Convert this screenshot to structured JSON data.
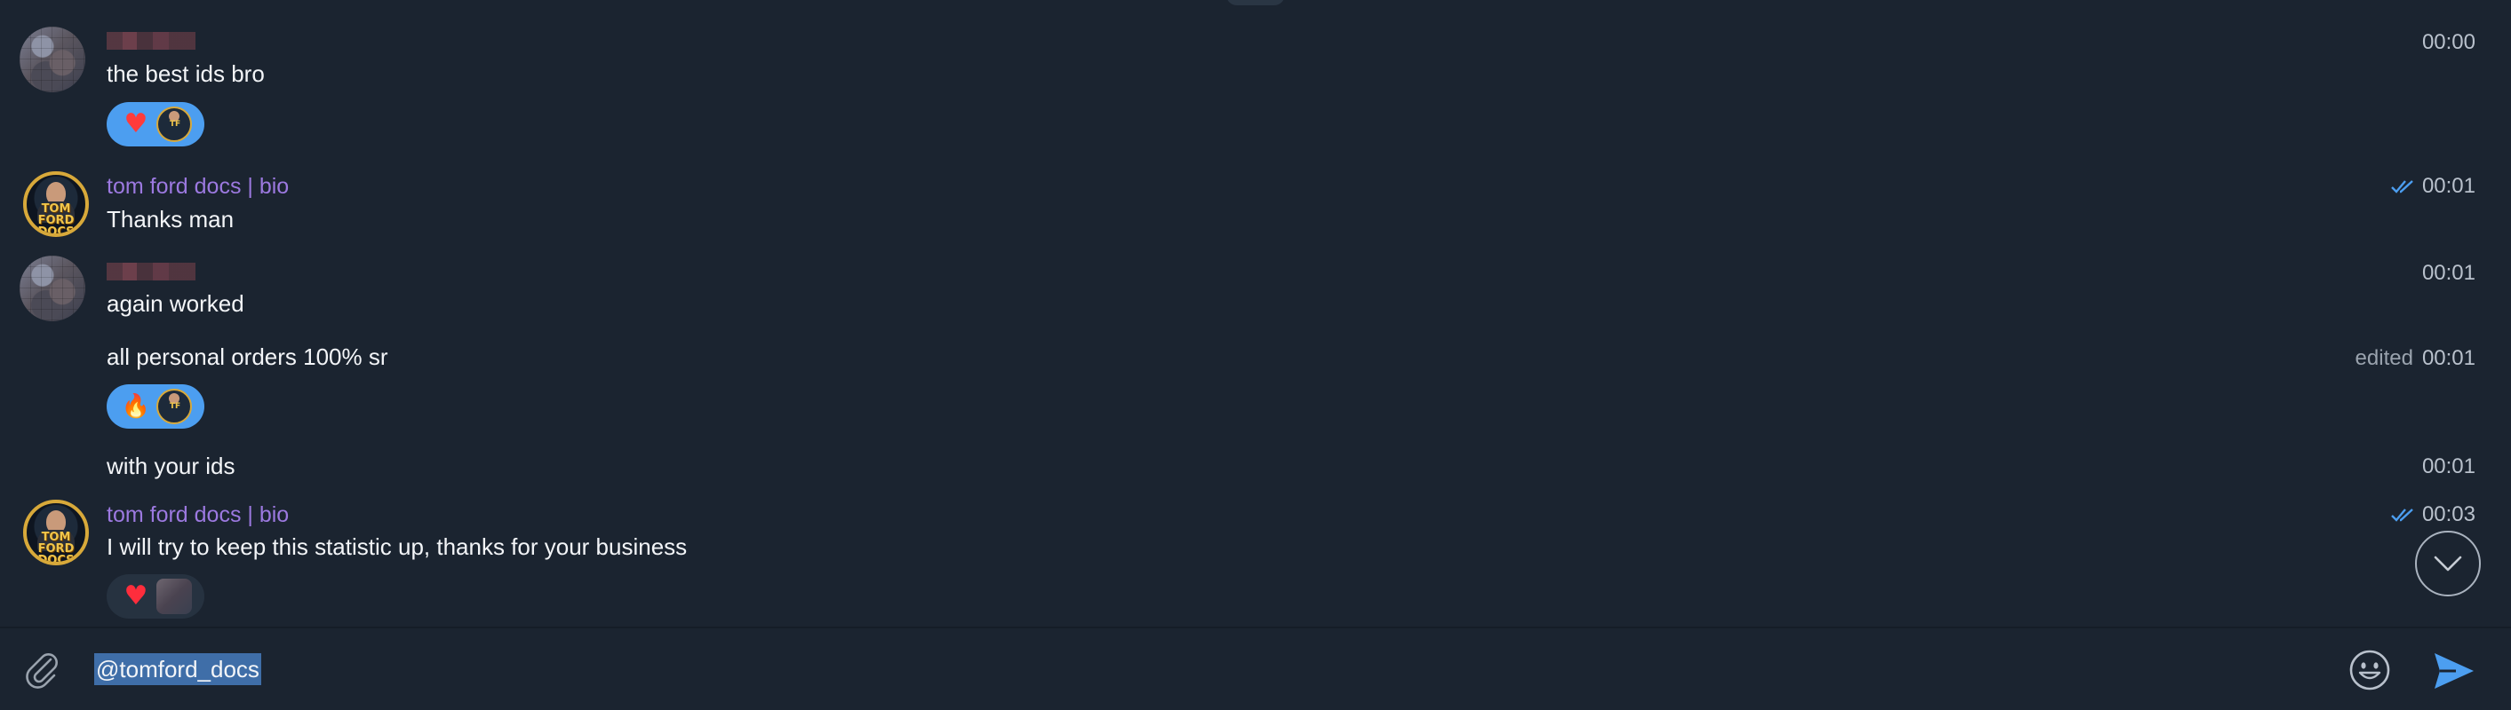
{
  "messages": [
    {
      "text": "the best ids bro",
      "time": "00:00"
    },
    {
      "sender": "tom ford docs | bio",
      "text": "Thanks man",
      "time": "00:01"
    },
    {
      "text": "again worked",
      "time": "00:01"
    },
    {
      "text": "all personal orders 100% sr",
      "edited_label": "edited",
      "time": "00:01"
    },
    {
      "text": "with your ids",
      "time": "00:01"
    },
    {
      "sender": "tom ford docs | bio",
      "text": "I will try to keep this statistic up, thanks for your business",
      "time": "00:03"
    }
  ],
  "avatar_logo_text": "TOM FORD DOCS",
  "reactions": [
    {
      "emoji": "❤️‍🔥",
      "emoji_fallback": "♥",
      "icon": "heart-on-fire-icon"
    },
    {
      "emoji": "🔥",
      "emoji_fallback": "🔥",
      "icon": "fire-icon"
    },
    {
      "emoji": "❤️",
      "emoji_fallback": "♥",
      "icon": "heart-icon"
    }
  ],
  "composer": {
    "text": "@tomford_docs"
  },
  "colors": {
    "background": "#1b2430",
    "accent_blue": "#4c9ef0",
    "sender_name": "#9c79e0",
    "selection": "#3f6ea8"
  },
  "icons": {
    "attach": "paperclip-icon",
    "emoji": "smiley-icon",
    "send": "send-arrow-icon",
    "scroll": "chevron-down-icon",
    "read": "double-check-icon"
  }
}
